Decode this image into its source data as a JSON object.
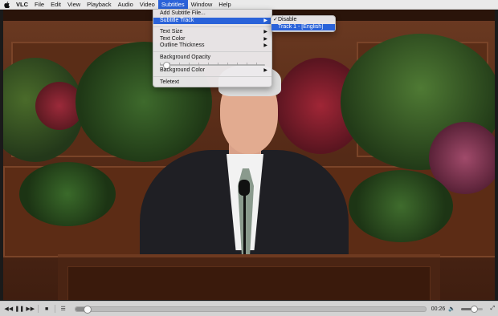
{
  "menubar": {
    "items": [
      "VLC",
      "File",
      "Edit",
      "View",
      "Playback",
      "Audio",
      "Video",
      "Subtitles",
      "Window",
      "Help"
    ],
    "active": "Subtitles"
  },
  "subtitles_menu": {
    "add_file": "Add Subtitle File...",
    "subtitle_track": "Subtitle Track",
    "text_size": "Text Size",
    "text_color": "Text Color",
    "outline_thickness": "Outline Thickness",
    "background_opacity": "Background Opacity",
    "background_color": "Background Color",
    "teletext": "Teletext"
  },
  "track_submenu": {
    "disable": "Disable",
    "track1": "Track 1 - [English]",
    "checked": "Disable",
    "highlighted": "Track 1 - [English]"
  },
  "controls": {
    "time": "00:26",
    "progress_fraction": 0.03,
    "volume_fraction": 0.55
  },
  "colors": {
    "accent": "#2a62d9"
  }
}
